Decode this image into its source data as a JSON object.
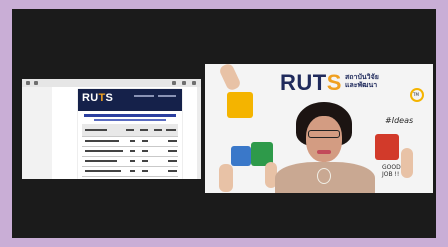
{
  "window": {
    "background": "#1b1b1b",
    "frame_color": "#c9aed6"
  },
  "shared_screen": {
    "document_logo": {
      "main": "RU",
      "accent": "T",
      "tail": "S"
    }
  },
  "camera": {
    "logo": {
      "main": "RUT",
      "accent": "S",
      "subtitle_line1": "สถาบันวิจัย",
      "subtitle_line2": "และพัฒนา"
    },
    "tags": {
      "ideas": "#Ideas",
      "good_job": "GOOD JOB !!",
      "tm": "TM"
    },
    "puzzle_colors": [
      "#f4b400",
      "#3a78c9",
      "#2e9a4a",
      "#d23a2a",
      "#f4b400"
    ]
  }
}
